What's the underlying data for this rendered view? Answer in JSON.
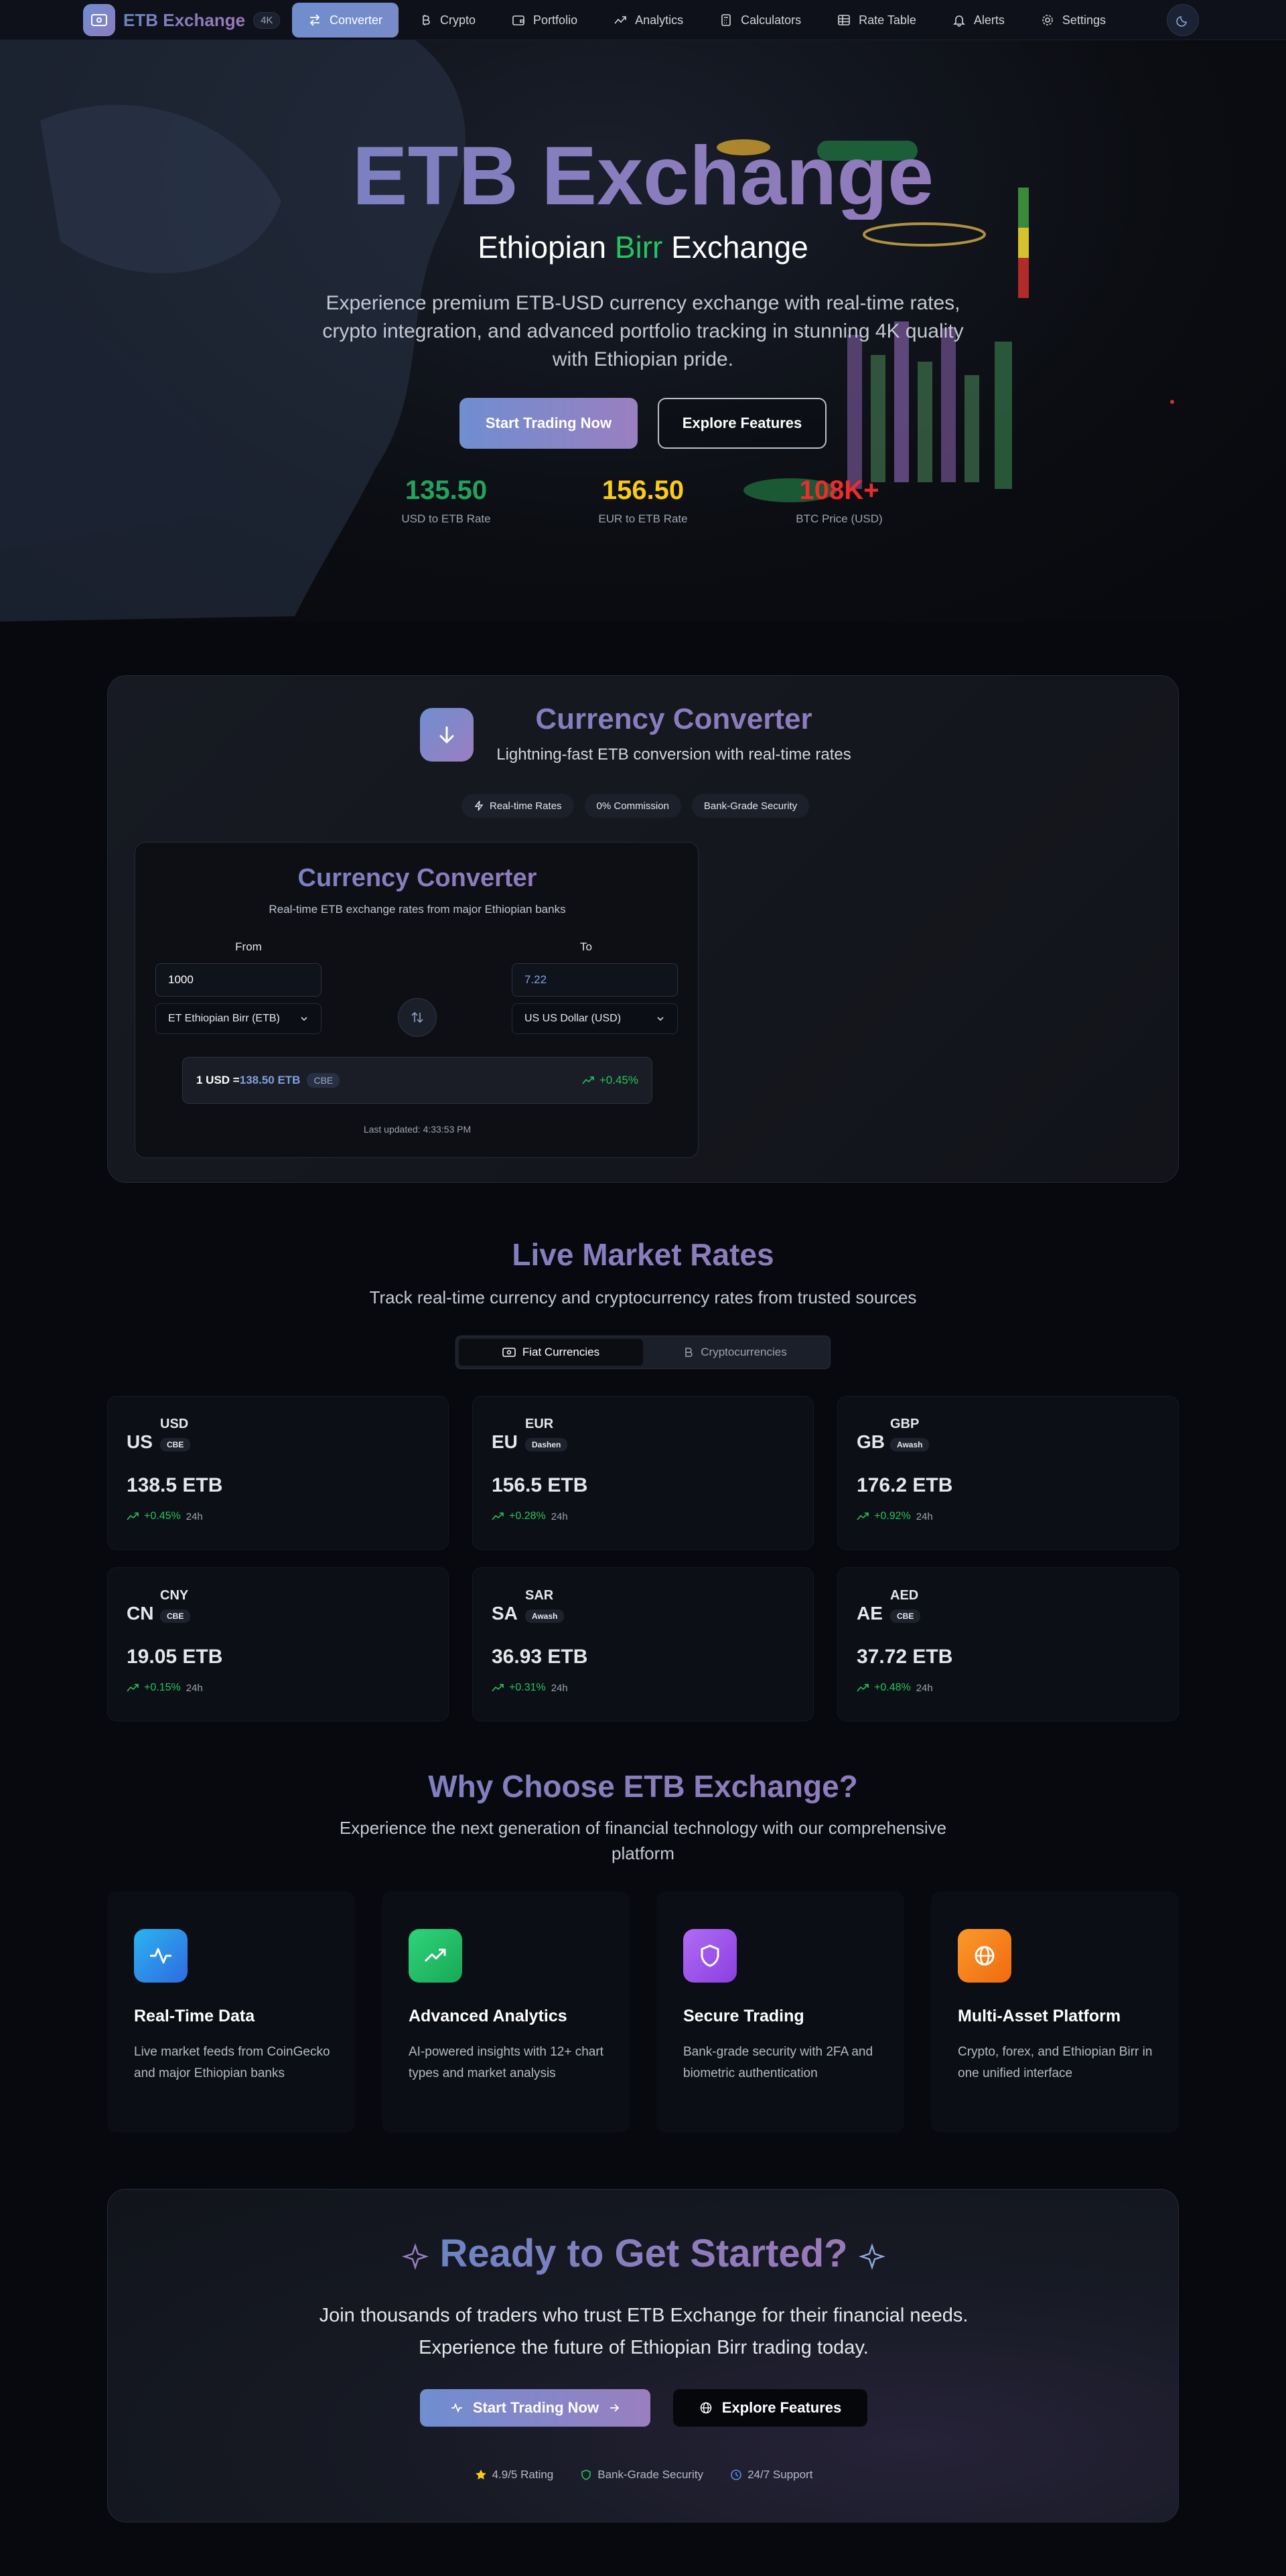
{
  "nav": {
    "brand": "ETB Exchange",
    "badge": "4K",
    "items": [
      {
        "label": "Converter",
        "icon": "arrows-exchange-icon",
        "active": true
      },
      {
        "label": "Crypto",
        "icon": "bitcoin-icon",
        "active": false
      },
      {
        "label": "Portfolio",
        "icon": "wallet-icon",
        "active": false
      },
      {
        "label": "Analytics",
        "icon": "trending-icon",
        "active": false
      },
      {
        "label": "Calculators",
        "icon": "calculator-icon",
        "active": false
      },
      {
        "label": "Rate Table",
        "icon": "table-icon",
        "active": false
      },
      {
        "label": "Alerts",
        "icon": "bell-icon",
        "active": false
      },
      {
        "label": "Settings",
        "icon": "gear-icon",
        "active": false
      }
    ],
    "theme_icon": "moon-icon"
  },
  "hero": {
    "title": "ETB Exchange",
    "subtitle_pre": "Ethiopian ",
    "subtitle_accent": "Birr",
    "subtitle_post": " Exchange",
    "description": "Experience premium ETB-USD currency exchange with real-time rates, crypto integration, and advanced portfolio tracking in stunning 4K quality with Ethiopian pride.",
    "primary_button": "Start Trading Now",
    "secondary_button": "Explore Features",
    "stats": [
      {
        "value": "135.50",
        "label": "USD to ETB Rate",
        "color": "#22a45d"
      },
      {
        "value": "156.50",
        "label": "EUR to ETB Rate",
        "color": "#facc15"
      },
      {
        "value": "108K+",
        "label": "BTC Price (USD)",
        "color": "#ef2b2b"
      }
    ]
  },
  "converter_section": {
    "title": "Currency Converter",
    "subtitle": "Lightning-fast ETB conversion with real-time rates",
    "pills": [
      "Real-time Rates",
      "0% Commission",
      "Bank-Grade Security"
    ],
    "card": {
      "title": "Currency Converter",
      "subtitle": "Real-time ETB exchange rates from major Ethiopian banks",
      "from_label": "From",
      "to_label": "To",
      "from_value": "1000",
      "to_value": "7.22",
      "from_currency": "ET Ethiopian Birr (ETB)",
      "to_currency": "US US Dollar (USD)",
      "rate_prefix": "1 USD = ",
      "rate_value": "138.50 ETB",
      "rate_bank": "CBE",
      "rate_change": "+0.45%",
      "updated": "Last updated: 4:33:53 PM"
    }
  },
  "market": {
    "title": "Live Market Rates",
    "subtitle": "Track real-time currency and cryptocurrency rates from trusted sources",
    "tabs": [
      {
        "label": "Fiat Currencies",
        "active": true
      },
      {
        "label": "Cryptocurrencies",
        "active": false
      }
    ],
    "rates": [
      {
        "flag": "US",
        "code": "USD",
        "bank": "CBE",
        "value": "138.5 ETB",
        "change": "+0.45%",
        "period": "24h"
      },
      {
        "flag": "EU",
        "code": "EUR",
        "bank": "Dashen",
        "value": "156.5 ETB",
        "change": "+0.28%",
        "period": "24h"
      },
      {
        "flag": "GB",
        "code": "GBP",
        "bank": "Awash",
        "value": "176.2 ETB",
        "change": "+0.92%",
        "period": "24h"
      },
      {
        "flag": "CN",
        "code": "CNY",
        "bank": "CBE",
        "value": "19.05 ETB",
        "change": "+0.15%",
        "period": "24h"
      },
      {
        "flag": "SA",
        "code": "SAR",
        "bank": "Awash",
        "value": "36.93 ETB",
        "change": "+0.31%",
        "period": "24h"
      },
      {
        "flag": "AE",
        "code": "AED",
        "bank": "CBE",
        "value": "37.72 ETB",
        "change": "+0.48%",
        "period": "24h"
      }
    ]
  },
  "why": {
    "title": "Why Choose ETB Exchange?",
    "subtitle": "Experience the next generation of financial technology with our comprehensive platform",
    "features": [
      {
        "title": "Real-Time Data",
        "desc": "Live market feeds from CoinGecko and major Ethiopian banks",
        "icon": "pulse-icon",
        "color": "#2f8cf0"
      },
      {
        "title": "Advanced Analytics",
        "desc": "AI-powered insights with 12+ chart types and market analysis",
        "icon": "trending-up-icon",
        "color": "#22c55e"
      },
      {
        "title": "Secure Trading",
        "desc": "Bank-grade security with 2FA and biometric authentication",
        "icon": "shield-icon",
        "color": "#a855f7"
      },
      {
        "title": "Multi-Asset Platform",
        "desc": "Crypto, forex, and Ethiopian Birr in one unified interface",
        "icon": "globe-icon",
        "color": "#f97316"
      }
    ]
  },
  "cta": {
    "title": "Ready to Get Started?",
    "subtitle": "Join thousands of traders who trust ETB Exchange for their financial needs. Experience the future of Ethiopian Birr trading today.",
    "primary_button": "Start Trading Now",
    "secondary_button": "Explore Features",
    "trust": [
      "4.9/5 Rating",
      "Bank-Grade Security",
      "24/7 Support"
    ]
  }
}
